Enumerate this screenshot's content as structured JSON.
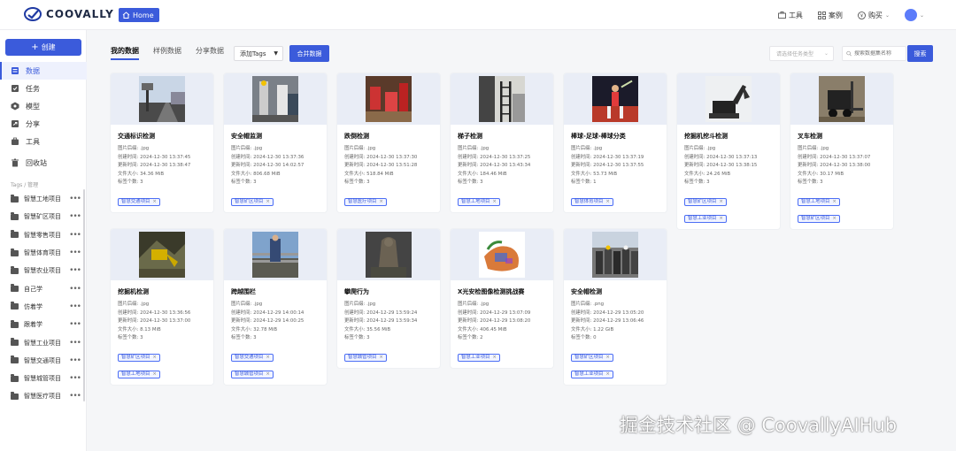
{
  "header": {
    "logo_text": "COOVALLY",
    "home_label": "Home",
    "tools_label": "工具",
    "cases_label": "案例",
    "buy_label": "购买"
  },
  "sidebar": {
    "create_label": "创建",
    "nav": [
      {
        "label": "数据",
        "icon": "database-icon",
        "active": true
      },
      {
        "label": "任务",
        "icon": "task-icon"
      },
      {
        "label": "模型",
        "icon": "model-icon"
      },
      {
        "label": "分享",
        "icon": "share-icon"
      },
      {
        "label": "工具",
        "icon": "tool-icon"
      },
      {
        "label": "回收站",
        "icon": "trash-icon"
      }
    ],
    "tags_title": "Tags / 管理",
    "projects": [
      "智慧工地项目",
      "智慧矿区项目",
      "智慧零售项目",
      "智慧体育项目",
      "智慧农业项目",
      "自己学",
      "仿着学",
      "跟着学",
      "智慧工业项目",
      "智慧交通项目",
      "智慧城管项目",
      "智慧医疗项目"
    ]
  },
  "toolbar": {
    "tabs": [
      "我的数据",
      "样例数据",
      "分享数据"
    ],
    "tags_select": "添加Tags",
    "merge_label": "合并数据",
    "type_placeholder": "请选择任务类型",
    "search_placeholder": "搜索数据集名称",
    "search_label": "搜索"
  },
  "labels": {
    "suffix": "图片后缀:",
    "created": "创建时间:",
    "updated": "更新时间:",
    "size": "文件大小:",
    "tag_count": "标签个数:"
  },
  "cards": [
    {
      "title": "交通标识检测",
      "suffix": ".jpg",
      "created": "2024-12-30 13:37:45",
      "updated": "2024-12-30 13:38:47",
      "size": "34.36 MiB",
      "tag_count": "3",
      "tags": [
        "智慧交通项目"
      ],
      "image": "street-photo-icon"
    },
    {
      "title": "安全帽监测",
      "suffix": ".jpg",
      "created": "2024-12-30 13:37:36",
      "updated": "2024-12-30 14:02:57",
      "size": "806.68 MiB",
      "tag_count": "3",
      "tags": [
        "智慧矿区项目"
      ],
      "image": "worker-photo-icon"
    },
    {
      "title": "跌倒检测",
      "suffix": ".jpg",
      "created": "2024-12-30 13:37:30",
      "updated": "2024-12-30 13:51:28",
      "size": "518.84 MiB",
      "tag_count": "3",
      "tags": [
        "智慧医疗项目"
      ],
      "image": "people-photo-icon"
    },
    {
      "title": "梯子检测",
      "suffix": ".jpg",
      "created": "2024-12-30 13:37:25",
      "updated": "2024-12-30 13:43:34",
      "size": "184.46 MiB",
      "tag_count": "3",
      "tags": [
        "智慧工地项目"
      ],
      "image": "ladder-photo-icon"
    },
    {
      "title": "棒球-足球-棒球分类",
      "suffix": ".jpg",
      "created": "2024-12-30 13:37:19",
      "updated": "2024-12-30 13:37:55",
      "size": "53.73 MiB",
      "tag_count": "1",
      "tags": [
        "智慧体育项目"
      ],
      "image": "sport-photo-icon"
    },
    {
      "title": "挖掘机挖斗检测",
      "suffix": ".jpg",
      "created": "2024-12-30 13:37:13",
      "updated": "2024-12-30 13:38:15",
      "size": "24.26 MiB",
      "tag_count": "3",
      "tags": [
        "智慧矿区项目",
        "智慧工业项目"
      ],
      "image": "excavator-photo-icon"
    },
    {
      "title": "叉车检测",
      "suffix": ".jpg",
      "created": "2024-12-30 13:37:07",
      "updated": "2024-12-30 13:38:00",
      "size": "30.17 MiB",
      "tag_count": "3",
      "tags": [
        "智慧工地项目",
        "智慧矿区项目"
      ],
      "image": "forklift-photo-icon"
    },
    {
      "title": "挖掘机检测",
      "suffix": ".jpg",
      "created": "2024-12-30 13:36:56",
      "updated": "2024-12-30 13:37:00",
      "size": "8.13 MiB",
      "tag_count": "3",
      "tags": [
        "智慧矿区项目",
        "智慧工地项目"
      ],
      "image": "machine-photo-icon"
    },
    {
      "title": "跨越围栏",
      "suffix": ".jpg",
      "created": "2024-12-29 14:00:14",
      "updated": "2024-12-29 14:00:25",
      "size": "32.78 MiB",
      "tag_count": "3",
      "tags": [
        "智慧交通项目",
        "智慧城管项目"
      ],
      "image": "fence-photo-icon"
    },
    {
      "title": "攀爬行为",
      "suffix": ".jpg",
      "created": "2024-12-29 13:59:24",
      "updated": "2024-12-29 13:59:34",
      "size": "35.56 MiB",
      "tag_count": "3",
      "tags": [
        "智慧城管项目"
      ],
      "image": "climb-photo-icon"
    },
    {
      "title": "X光安检图像检测挑战赛",
      "suffix": ".jpg",
      "created": "2024-12-29 13:07:09",
      "updated": "2024-12-29 13:08:20",
      "size": "406.45 MiB",
      "tag_count": "2",
      "tags": [
        "智慧工业项目"
      ],
      "image": "xray-photo-icon"
    },
    {
      "title": "安全帽检测",
      "suffix": ".png",
      "created": "2024-12-29 13:05:20",
      "updated": "2024-12-29 13:06:46",
      "size": "1.22 GiB",
      "tag_count": "0",
      "tags": [
        "智慧矿区项目",
        "智慧工业项目"
      ],
      "image": "crowd-photo-icon"
    }
  ],
  "watermark": "掘金技术社区 @ CoovallyAIHub",
  "colors": {
    "accent": "#3b5bdb",
    "accent_light": "#eef1fd",
    "tag_border": "#4c6ef5"
  }
}
